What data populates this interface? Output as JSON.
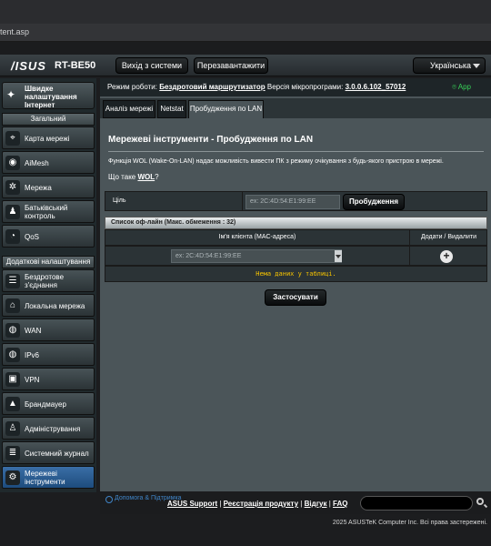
{
  "browser": {
    "url": "tent.asp"
  },
  "header": {
    "brand": "/ISUS",
    "model": "RT-BE50",
    "logout": "Вихід з системи",
    "reboot": "Перезавантажити",
    "language": "Українська"
  },
  "info": {
    "mode_label": "Режим роботи:",
    "mode_value": "Бездротовий маршрутизатор",
    "fw_label": "Версія мікропрограми:",
    "fw_value": "3.0.0.6.102_57012",
    "app_label": "App"
  },
  "sidebar": {
    "quick": "Швидке налаштування Інтернет",
    "general_header": "Загальний",
    "general": [
      {
        "label": "Карта мережі"
      },
      {
        "label": "AiMesh"
      },
      {
        "label": "Мережа"
      },
      {
        "label": "Батьківський контроль"
      },
      {
        "label": "QoS"
      }
    ],
    "advanced_header": "Додаткові налаштування",
    "advanced": [
      {
        "label": "Бездротове з'єднання"
      },
      {
        "label": "Локальна мережа"
      },
      {
        "label": "WAN"
      },
      {
        "label": "IPv6"
      },
      {
        "label": "VPN"
      },
      {
        "label": "Брандмауер"
      },
      {
        "label": "Адміністрування"
      },
      {
        "label": "Системний журнал"
      },
      {
        "label": "Мережеві інструменти"
      }
    ]
  },
  "tabs": [
    {
      "label": "Аналіз мережі"
    },
    {
      "label": "Netstat"
    },
    {
      "label": "Пробудження по LAN"
    }
  ],
  "panel": {
    "title": "Мережеві інструменти - Пробудження по LAN",
    "description": "Функція WOL (Wake-On-LAN) надає можливість вивести ПК з режиму очікування з будь-якого пристрою в мережі.",
    "wol_question_prefix": "Що таке ",
    "wol_link": "WOL",
    "wol_question_suffix": "?",
    "target_label": "Ціль",
    "target_placeholder": "ex: 2C:4D:54:E1:99:EE",
    "wake_button": "Пробудження",
    "list_header": "Список оф-лайн (Макс. обмеження : 32)",
    "col_client": "Ім'я клієнта (MAC-адреса)",
    "col_action": "Додати / Видалити",
    "client_placeholder": "ex: 2C:4D:54:E1:99:EE",
    "empty": "Нема даних у таблиці.",
    "apply": "Застосувати"
  },
  "footer": {
    "help": "Допомога & Підтримка",
    "links": [
      "ASUS Support",
      "Реєстрація продукту",
      "Відгук",
      "FAQ"
    ],
    "copyright": "2025 ASUSTeK Computer Inc. Всі права застережені."
  }
}
